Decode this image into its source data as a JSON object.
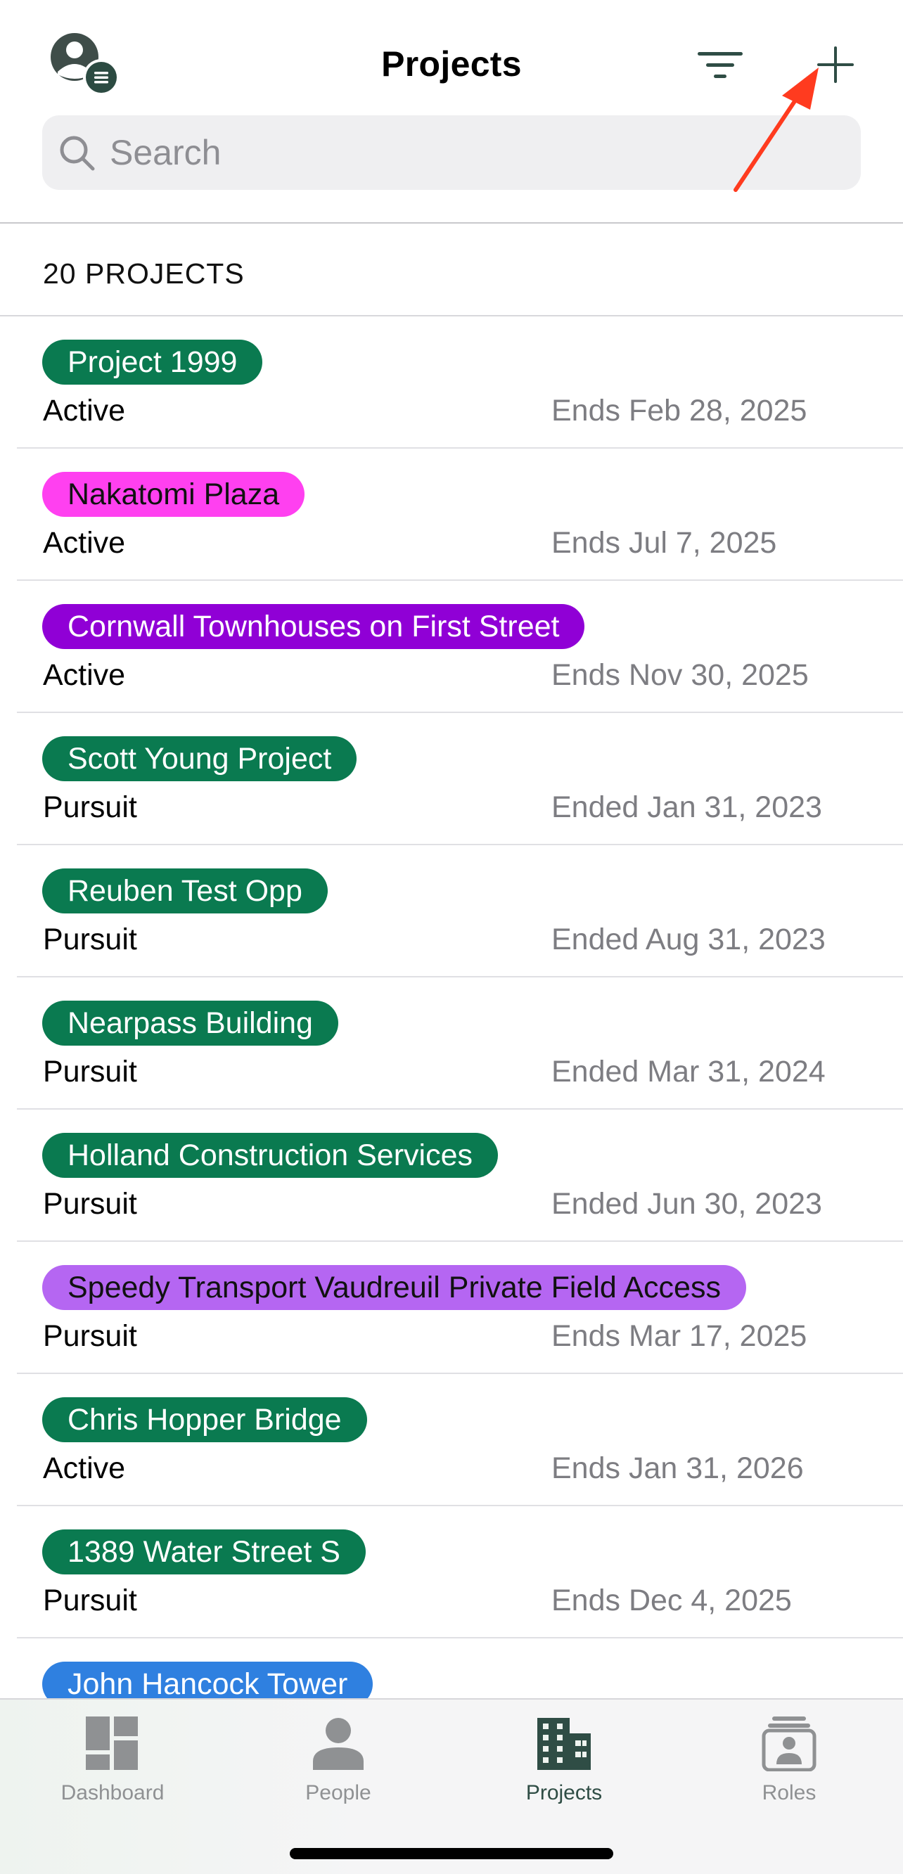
{
  "header": {
    "title": "Projects",
    "search_placeholder": "Search"
  },
  "count_label": "20 PROJECTS",
  "projects": [
    {
      "name": "Project 1999",
      "status": "Active",
      "date": "Ends Feb 28, 2025",
      "color": "#0a7a50"
    },
    {
      "name": "Nakatomi Plaza",
      "status": "Active",
      "date": "Ends Jul 7, 2025",
      "color": "#ff40f0",
      "text_color": "#111111"
    },
    {
      "name": "Cornwall Townhouses on First Street",
      "status": "Active",
      "date": "Ends Nov 30, 2025",
      "color": "#9000d6"
    },
    {
      "name": "Scott Young Project",
      "status": "Pursuit",
      "date": "Ended Jan 31, 2023",
      "color": "#0a7a50"
    },
    {
      "name": "Reuben Test Opp",
      "status": "Pursuit",
      "date": "Ended Aug 31, 2023",
      "color": "#0a7a50"
    },
    {
      "name": "Nearpass Building",
      "status": "Pursuit",
      "date": "Ended Mar 31, 2024",
      "color": "#0a7a50"
    },
    {
      "name": "Holland Construction Services",
      "status": "Pursuit",
      "date": "Ended Jun 30, 2023",
      "color": "#0a7a50"
    },
    {
      "name": "Speedy Transport Vaudreuil Private Field Access",
      "status": "Pursuit",
      "date": "Ends Mar 17, 2025",
      "color": "#b566f2",
      "text_color": "#111111"
    },
    {
      "name": "Chris Hopper Bridge",
      "status": "Active",
      "date": "Ends Jan 31, 2026",
      "color": "#0a7a50"
    },
    {
      "name": "1389 Water Street S",
      "status": "Pursuit",
      "date": "Ends Dec 4, 2025",
      "color": "#0a7a50"
    },
    {
      "name": "John Hancock Tower",
      "status": "",
      "date": "",
      "color": "#2f80e0"
    }
  ],
  "tabs": [
    {
      "label": "Dashboard",
      "icon": "dashboard-icon"
    },
    {
      "label": "People",
      "icon": "person-icon"
    },
    {
      "label": "Projects",
      "icon": "building-icon",
      "active": true
    },
    {
      "label": "Roles",
      "icon": "roles-icon"
    }
  ],
  "colors": {
    "accent": "#2f4d45",
    "annotation_arrow": "#ff3b1f"
  }
}
